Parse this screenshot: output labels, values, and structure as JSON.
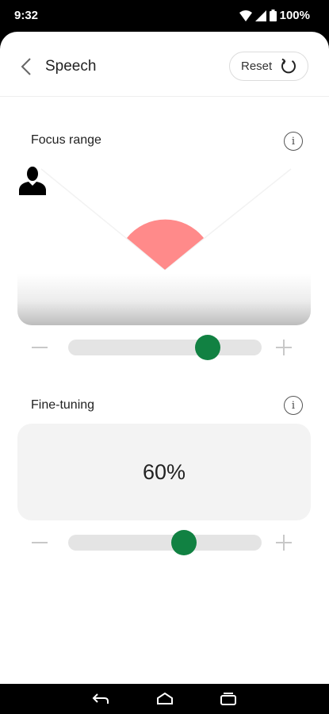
{
  "status_bar": {
    "time": "9:32",
    "battery_percent": "100%"
  },
  "header": {
    "title": "Speech",
    "reset_label": "Reset"
  },
  "focus_range": {
    "title": "Focus range",
    "slider_value": 0.72,
    "cone_color": "#ff8a8a"
  },
  "fine_tuning": {
    "title": "Fine-tuning",
    "value_text": "60%",
    "slider_value": 0.6
  },
  "colors": {
    "accent": "#118142"
  },
  "icons": {
    "back": "chevron-left-icon",
    "reset": "refresh-icon",
    "info": "info-icon",
    "user": "person-icon",
    "nav_back": "nav-back-icon",
    "nav_home": "nav-home-icon",
    "nav_recents": "nav-recents-icon"
  }
}
